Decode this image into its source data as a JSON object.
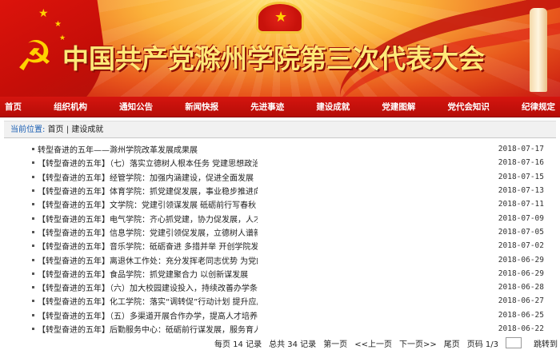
{
  "banner": {
    "title": "中国共产党滁州学院第三次代表大会"
  },
  "nav": {
    "items": [
      "首页",
      "组织机构",
      "通知公告",
      "新闻快报",
      "先进事迹",
      "建设成就",
      "党建图解",
      "党代会知识",
      "纪律规定"
    ]
  },
  "breadcrumb": {
    "label": "当前位置:",
    "home": "首页",
    "separator": "|",
    "current": "建设成就"
  },
  "articles": [
    {
      "title": "转型奋进的五年——滁州学院改革发展成果展",
      "date": "2018-07-17"
    },
    {
      "title": "【转型奋进的五年】（七）落实立德树人根本任务 党建思想政治工...",
      "date": "2018-07-16"
    },
    {
      "title": "【转型奋进的五年】经管学院：加强内涵建设，促进全面发展",
      "date": "2018-07-15"
    },
    {
      "title": "【转型奋进的五年】体育学院：抓党建促发展，事业稳步推进向前",
      "date": "2018-07-13"
    },
    {
      "title": "【转型奋进的五年】文学院：党建引领谋发展 砥砺前行写春秋",
      "date": "2018-07-11"
    },
    {
      "title": "【转型奋进的五年】电气学院：齐心抓党建，协力促发展，人才培养...",
      "date": "2018-07-09"
    },
    {
      "title": "【转型奋进的五年】信息学院：党建引领促发展，立德树人谱新篇",
      "date": "2018-07-05"
    },
    {
      "title": "【转型奋进的五年】音乐学院：砥砺奋进 多措并举 开创学院发展新...",
      "date": "2018-07-02"
    },
    {
      "title": "【转型奋进的五年】离退休工作处：充分发挥老同志优势 为党的事...",
      "date": "2018-06-29"
    },
    {
      "title": "【转型奋进的五年】食品学院：抓党建聚合力 以创新谋发展",
      "date": "2018-06-29"
    },
    {
      "title": "【转型奋进的五年】（六）加大校园建设投入，持续改善办学条件",
      "date": "2018-06-28"
    },
    {
      "title": "【转型奋进的五年】化工学院：落实“调转促”行动计划 提升应用...",
      "date": "2018-06-27"
    },
    {
      "title": "【转型奋进的五年】（五）多渠道开展合作办学，提高人才培养国际...",
      "date": "2018-06-25"
    },
    {
      "title": "【转型奋进的五年】后勤服务中心：砥砺前行谋发展，服务育人谱新...",
      "date": "2018-06-22"
    }
  ],
  "pager": {
    "per_page": "每页 14 记录",
    "total": "总共 34 记录",
    "first": "第一页",
    "prev": "<<上一页",
    "next": "下一页>>",
    "last": "尾页",
    "page_info": "页码 1/3",
    "goto": "跳转到"
  },
  "colors": {
    "nav_bg": "#c4100b",
    "breadcrumb_label": "#1a5fb4",
    "title_gold": "#ffe978"
  }
}
